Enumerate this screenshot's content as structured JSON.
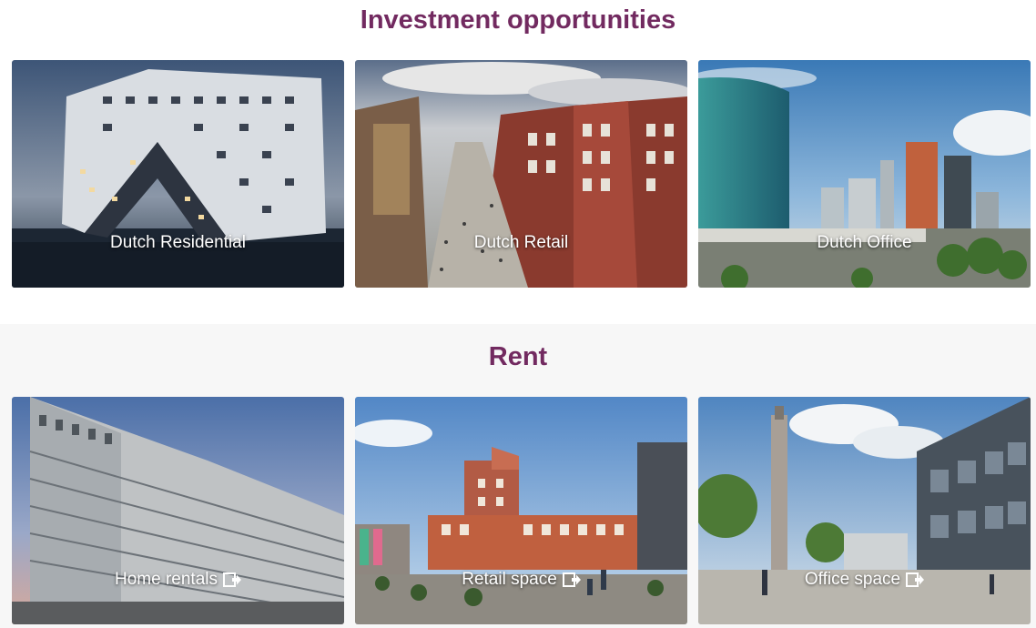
{
  "investment": {
    "heading": "Investment opportunities",
    "cards": [
      {
        "label": "Dutch Residential"
      },
      {
        "label": "Dutch Retail"
      },
      {
        "label": "Dutch Office"
      }
    ]
  },
  "rent": {
    "heading": "Rent",
    "cards": [
      {
        "label": "Home rentals",
        "icon": "external-link-icon"
      },
      {
        "label": "Retail space",
        "icon": "external-link-icon"
      },
      {
        "label": "Office space",
        "icon": "external-link-icon"
      }
    ]
  },
  "colors": {
    "heading": "#722a60",
    "rent_background": "#f7f7f7"
  }
}
